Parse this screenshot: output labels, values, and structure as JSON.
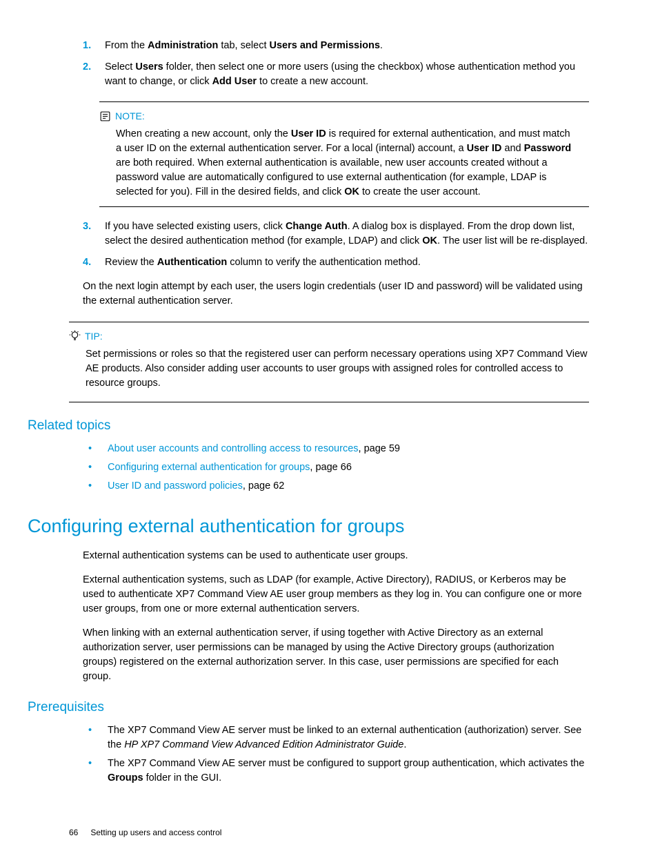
{
  "steps": {
    "s1": {
      "num": "1.",
      "parts": [
        "From the ",
        "Administration",
        " tab, select ",
        "Users and Permissions",
        "."
      ]
    },
    "s2": {
      "num": "2.",
      "parts": [
        "Select ",
        "Users",
        " folder, then select one or more users (using the checkbox) whose authentication method you want to change, or click ",
        "Add User",
        " to create a new account."
      ]
    },
    "s3": {
      "num": "3.",
      "parts": [
        "If you have selected existing users, click ",
        "Change Auth",
        ". A dialog box is displayed. From the drop down list, select the desired authentication method (for example, LDAP) and click ",
        "OK",
        ". The user list will be re-displayed."
      ]
    },
    "s4": {
      "num": "4.",
      "parts": [
        "Review the ",
        "Authentication",
        " column to verify the authentication method."
      ]
    }
  },
  "note": {
    "label": "NOTE:",
    "parts": [
      "When creating a new account, only the ",
      "User ID",
      " is required for external authentication, and must match a user ID on the external authentication server. For a local (internal) account, a ",
      "User ID",
      " and ",
      "Password",
      " are both required. When external authentication is available, new user accounts created without a password value are automatically configured to use external authentication (for example, LDAP is selected for you). Fill in the desired fields, and click ",
      "OK",
      " to create the user account."
    ]
  },
  "after_steps_para": "On the next login attempt by each user, the users login credentials (user ID and password) will be validated using the external authentication server.",
  "tip": {
    "label": "TIP:",
    "body": "Set permissions or roles so that the registered user can perform necessary operations using XP7 Command View AE products. Also consider adding user accounts to user groups with assigned roles for controlled access to resource groups."
  },
  "related": {
    "title": "Related topics",
    "items": [
      {
        "link": "About user accounts and controlling access to resources",
        "rest": ", page 59"
      },
      {
        "link": "Configuring external authentication for groups",
        "rest": ", page 66"
      },
      {
        "link": "User ID and password policies",
        "rest": ", page 62"
      }
    ]
  },
  "section": {
    "title": "Configuring external authentication for groups",
    "p1": "External authentication systems can be used to authenticate user groups.",
    "p2": "External authentication systems, such as LDAP (for example, Active Directory), RADIUS, or Kerberos may be used to authenticate XP7 Command View AE user group members as they log in. You can configure one or more user groups, from one or more external authentication servers.",
    "p3": "When linking with an external authentication server, if using together with Active Directory as an external authorization server, user permissions can be managed by using the Active Directory groups (authorization groups) registered on the external authorization server. In this case, user permissions are specified for each group."
  },
  "prereq": {
    "title": "Prerequisites",
    "items": [
      {
        "parts": [
          "The XP7 Command View AE server must be linked to an external authentication (authorization) server. See the ",
          "HP XP7 Command View Advanced Edition Administrator Guide",
          "."
        ]
      },
      {
        "parts": [
          "The XP7 Command View AE server must be configured to support group authentication, which activates the ",
          "Groups",
          " folder in the GUI."
        ]
      }
    ]
  },
  "footer": {
    "pagenum": "66",
    "chapter": "Setting up users and access control"
  }
}
